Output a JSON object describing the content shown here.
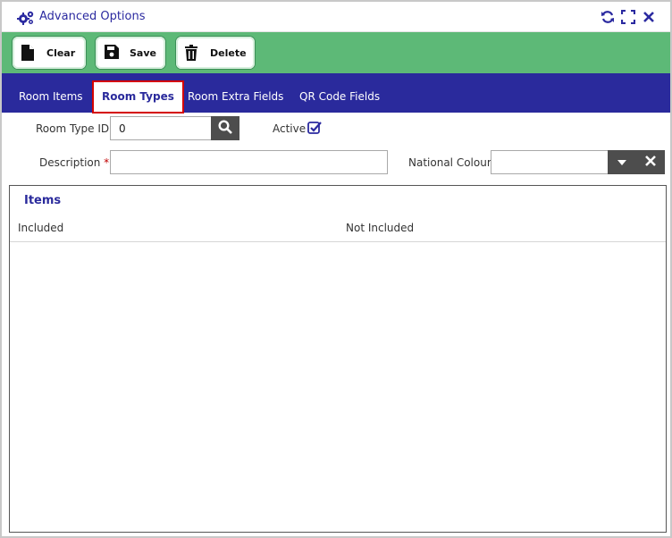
{
  "window": {
    "title": "Advanced Options",
    "controls": [
      "refresh-icon",
      "expand-icon",
      "close-icon"
    ]
  },
  "toolbar": {
    "clear_label": "Clear",
    "save_label": "Save",
    "delete_label": "Delete"
  },
  "tabs": [
    {
      "label": "Room Items",
      "active": false
    },
    {
      "label": "Room Types",
      "active": true
    },
    {
      "label": "Room Extra Fields",
      "active": false
    },
    {
      "label": "QR Code Fields",
      "active": false
    }
  ],
  "form": {
    "room_type_id_label": "Room Type ID",
    "room_type_id_value": "0",
    "active_label": "Active",
    "active_checked": true,
    "description_label": "Description",
    "description_required_mark": "*",
    "description_value": "",
    "national_colour_label": "National Colour",
    "national_colour_value": ""
  },
  "items": {
    "title": "Items",
    "columns": [
      "Included",
      "Not Included"
    ],
    "included": [],
    "not_included": []
  },
  "colors": {
    "toolbar_bg": "#5db977",
    "tabs_bg": "#2a2a9c",
    "accent": "#2b2aa0",
    "active_tab_outline": "#d40000"
  }
}
